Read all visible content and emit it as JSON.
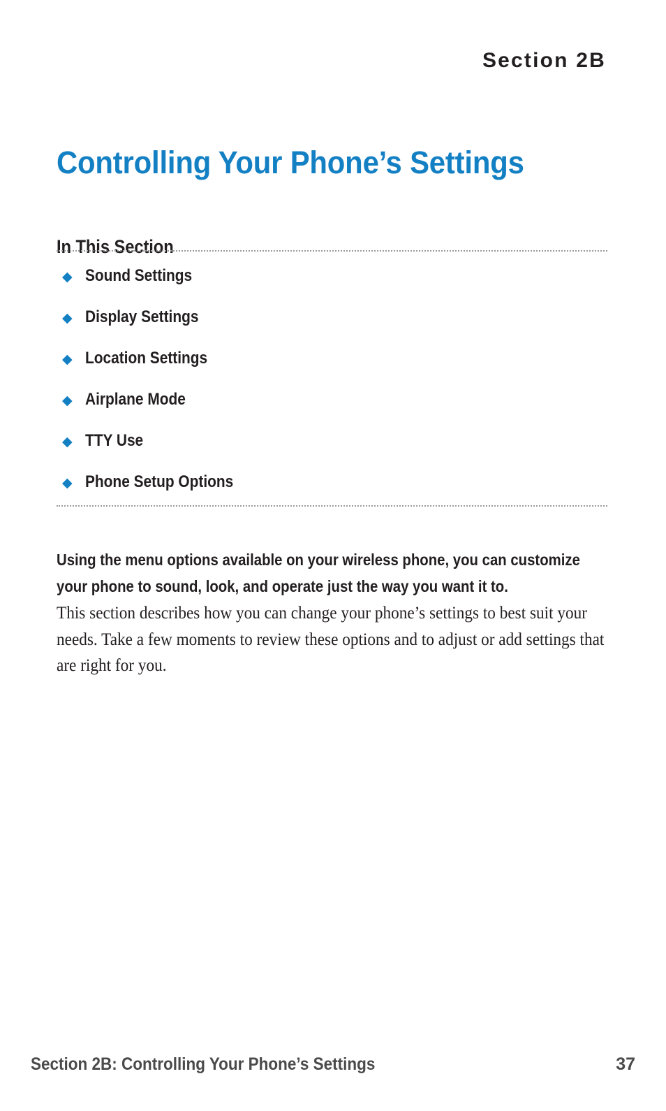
{
  "page": {
    "background_color": "#ffffff",
    "accent_color": "#1480C4",
    "text_color": "#231f20",
    "footer_color": "#4a4a4a",
    "rule_color": "#9b9b9b"
  },
  "header": {
    "section_label": "Section 2B"
  },
  "title": {
    "text": "Controlling Your Phone’s Settings"
  },
  "in_this_section": {
    "heading": "In This Section",
    "bullet_glyph": "◆",
    "items": [
      {
        "label": "Sound Settings"
      },
      {
        "label": "Display Settings"
      },
      {
        "label": "Location Settings"
      },
      {
        "label": "Airplane Mode"
      },
      {
        "label": "TTY Use"
      },
      {
        "label": "Phone Setup Options"
      }
    ]
  },
  "intro": {
    "lead": "Using the menu options available on your wireless phone, you can customize your phone to sound, look, and operate just the way you want it to.",
    "body": "This section describes how you can change your phone’s settings to best suit your needs. Take a few moments to review these options and to adjust or add settings that are right for you."
  },
  "footer": {
    "left": "Section 2B: Controlling Your Phone’s Settings",
    "page_number": "37"
  }
}
